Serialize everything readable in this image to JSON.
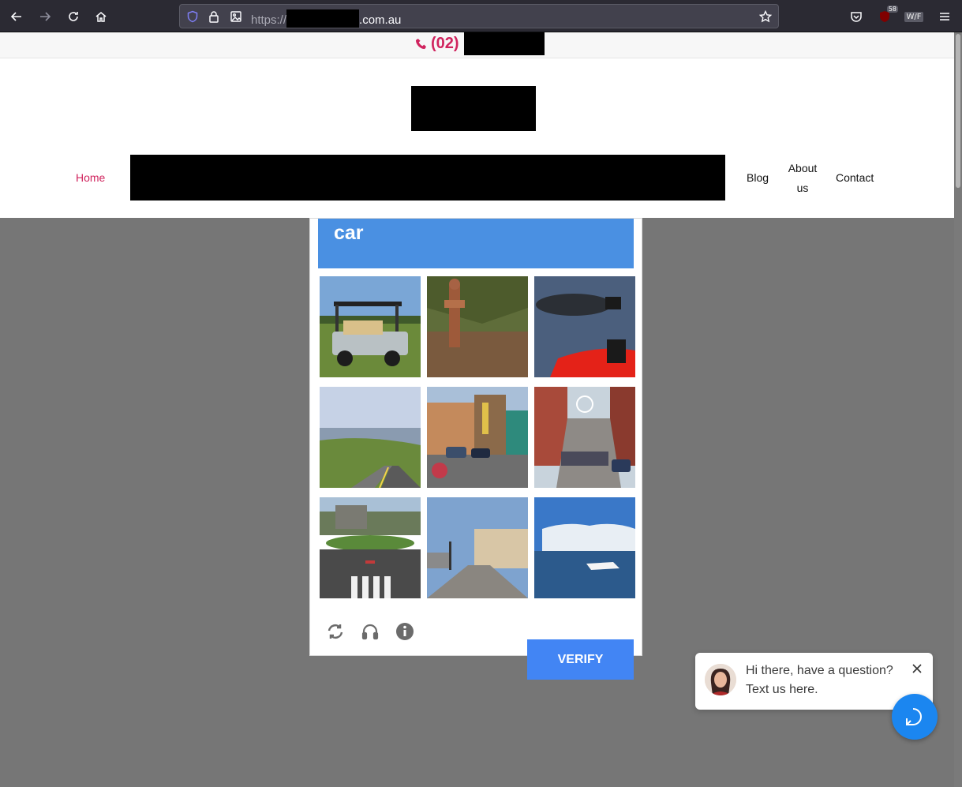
{
  "browser": {
    "url_prefix": "https://",
    "url_suffix": ".com.au",
    "extension_badge": "58",
    "extension_label": "W/F"
  },
  "topbar": {
    "phone_prefix": "(02)"
  },
  "menu": {
    "home": "Home",
    "blog": "Blog",
    "about_line1": "About",
    "about_line2": "us",
    "contact": "Contact"
  },
  "captcha": {
    "target_word": "car",
    "verify_label": "VERIFY",
    "tiles": [
      "golf-cart",
      "fire-hydrant",
      "inflatable-boats",
      "coastal-road",
      "town-street-with-cars",
      "city-street-crowded",
      "roundabout-crosswalk",
      "european-street",
      "speedboat-sea"
    ]
  },
  "chat": {
    "line1": "Hi there, have a question?",
    "line2": "Text us here."
  },
  "colors": {
    "accent": "#d0245e",
    "captcha_header": "#4a90e2",
    "verify": "#4285f4",
    "chat_fab": "#1b86f0"
  }
}
